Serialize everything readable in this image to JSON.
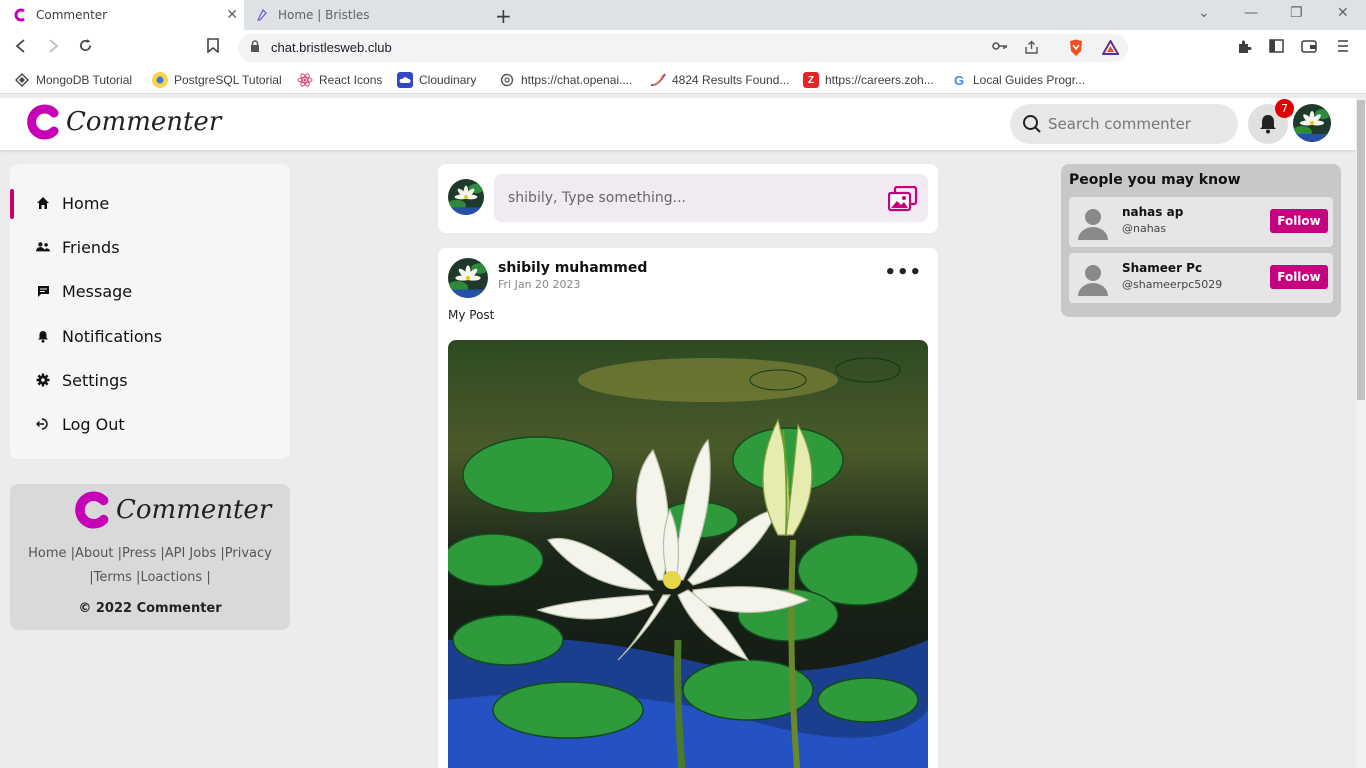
{
  "browser": {
    "tabs": [
      {
        "title": "Commenter",
        "active": true
      },
      {
        "title": "Home | Bristles",
        "active": false
      }
    ],
    "url": "chat.bristlesweb.club",
    "bookmarks": [
      {
        "label": "MongoDB Tutorial",
        "icon": "diamond-icon",
        "color": "#4a4a4a"
      },
      {
        "label": "PostgreSQL Tutorial",
        "icon": "postgres-icon",
        "color": "#f39c12"
      },
      {
        "label": "React Icons",
        "icon": "react-icon",
        "color": "#e0457b"
      },
      {
        "label": "Cloudinary",
        "icon": "cloudinary-icon",
        "color": "#3448c5"
      },
      {
        "label": "https://chat.openai....",
        "icon": "openai-icon",
        "color": "#555555"
      },
      {
        "label": "4824 Results Found...",
        "icon": "swoosh-icon",
        "color": "#8e44ad"
      },
      {
        "label": "https://careers.zoh...",
        "icon": "zoho-icon",
        "color": "#e42527"
      },
      {
        "label": "Local Guides Progr...",
        "icon": "google-icon",
        "color": "#4285f4"
      }
    ]
  },
  "app": {
    "brand": "Commenter",
    "brand_color": "#c600b6",
    "search": {
      "placeholder": "Search commenter"
    },
    "notification_count": "7",
    "nav": [
      {
        "label": "Home",
        "icon": "home-icon",
        "active": true
      },
      {
        "label": "Friends",
        "icon": "friends-icon",
        "active": false
      },
      {
        "label": "Message",
        "icon": "message-icon",
        "active": false
      },
      {
        "label": "Notifications",
        "icon": "bell-icon",
        "active": false
      },
      {
        "label": "Settings",
        "icon": "gear-icon",
        "active": false
      },
      {
        "label": "Log Out",
        "icon": "logout-icon",
        "active": false
      }
    ],
    "footer": {
      "links_line1": "Home |About |Press |API Jobs |Privacy",
      "links_line2": "|Terms |Loactions |",
      "copyright": "© 2022 Commenter"
    },
    "composer": {
      "placeholder": "shibily, Type something..."
    },
    "post": {
      "author": "shibily muhammed",
      "date": "Fri Jan 20 2023",
      "text": "My Post",
      "more": "•••"
    },
    "people": {
      "title": "People you may know",
      "items": [
        {
          "name": "nahas ap",
          "handle": "@nahas",
          "button": "Follow"
        },
        {
          "name": "Shameer Pc",
          "handle": "@shameerpc5029",
          "button": "Follow"
        }
      ]
    }
  }
}
